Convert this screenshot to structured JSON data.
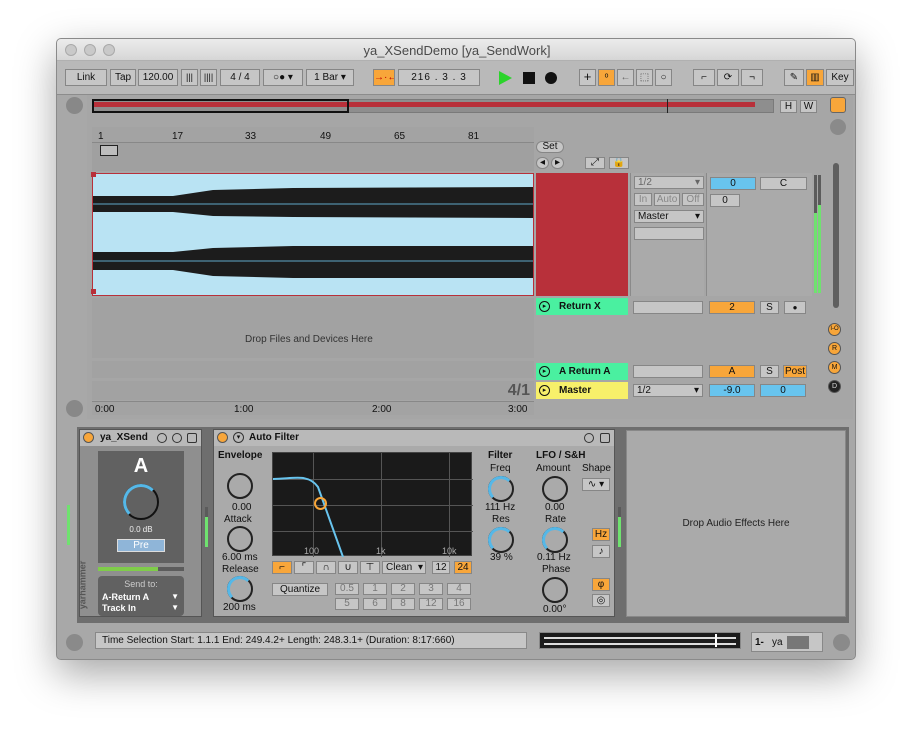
{
  "window": {
    "title": "ya_XSendDemo  [ya_SendWork]"
  },
  "control_bar": {
    "link": "Link",
    "tap": "Tap",
    "tempo": "120.00",
    "sig_num": "4",
    "sig_sep": "/",
    "sig_den": "4",
    "quant": "1 Bar",
    "pos_bar": "216",
    "pos_beat": "3",
    "pos_sixteenth": "3",
    "key": "Key"
  },
  "overview": {
    "h": "H",
    "w": "W"
  },
  "ruler": {
    "markers": [
      "1",
      "17",
      "33",
      "49",
      "65",
      "81"
    ],
    "set": "Set"
  },
  "time_ruler": [
    "0:00",
    "1:00",
    "2:00",
    "3:00"
  ],
  "track1": {
    "input": "1/2",
    "monitor_in": "In",
    "monitor_auto": "Auto",
    "monitor_off": "Off",
    "output": "Master",
    "volume": "0",
    "pan": "C",
    "send": "0"
  },
  "drop_files": "Drop Files and Devices Here",
  "loop_ratio": "4/1",
  "return_x": {
    "name": "Return X",
    "volume": "2",
    "solo": "S"
  },
  "return_a": {
    "name": "A Return A",
    "volume": "A",
    "solo": "S",
    "post": "Post"
  },
  "master": {
    "name": "Master",
    "output": "1/2",
    "volume": "-9.0",
    "pan": "0"
  },
  "side_buttons": [
    "I-O",
    "R",
    "M",
    "D"
  ],
  "device_xsend": {
    "title": "ya_XSend",
    "letter": "A",
    "db": "0.0 dB",
    "pre": "Pre",
    "send_to": "Send to:",
    "dest1": "A-Return A",
    "dest2": "Track In",
    "brand": "yarhammer"
  },
  "auto_filter": {
    "title": "Auto Filter",
    "envelope": "Envelope",
    "env_value": "0.00",
    "attack": "Attack",
    "attack_value": "6.00 ms",
    "release": "Release",
    "release_value": "200 ms",
    "freq_labels": [
      "100",
      "1k",
      "10k"
    ],
    "circuit": "Clean",
    "slope12": "12",
    "slope24": "24",
    "quantize": "Quantize",
    "q_values": [
      "0.5",
      "1",
      "2",
      "3",
      "4",
      "5",
      "6",
      "8",
      "12",
      "16"
    ],
    "filter": "Filter",
    "freq": "Freq",
    "freq_value": "111 Hz",
    "res": "Res",
    "res_value": "39 %",
    "lfo": "LFO / S&H",
    "amount": "Amount",
    "amount_value": "0.00",
    "shape": "Shape",
    "rate": "Rate",
    "rate_value": "0.11 Hz",
    "hz": "Hz",
    "phase": "Phase",
    "phase_value": "0.00°"
  },
  "drop_effects": "Drop Audio Effects Here",
  "status": {
    "text": "Time Selection    Start: 1.1.1    End: 249.4.2+    Length: 248.3.1+  (Duration: 8:17:660)",
    "track": "1-",
    "track_name": "ya"
  },
  "colors": {
    "accent": "#f8a63a",
    "clip_red": "#b8303a",
    "return_green": "#4af0a0",
    "master_yellow": "#f7f06a",
    "blue": "#68c4ee"
  }
}
